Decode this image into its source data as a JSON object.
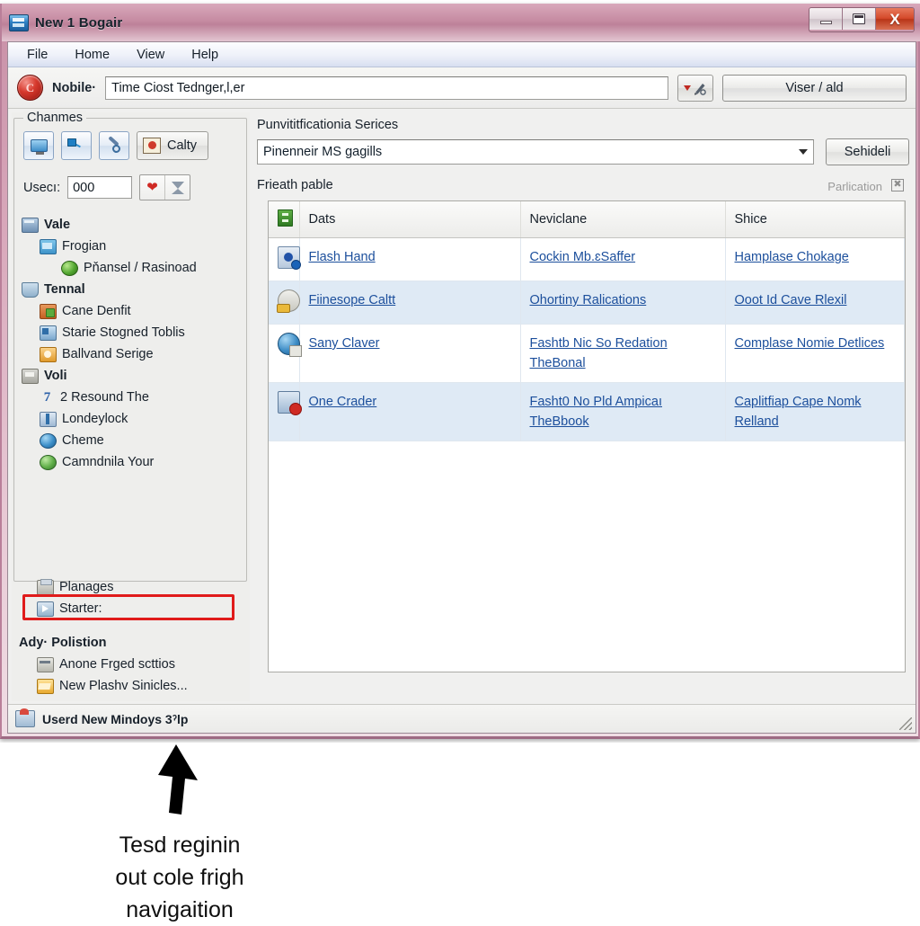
{
  "window": {
    "title": "New 1 Bogair",
    "logo_icon": "window-app-icon",
    "controls": {
      "minimize": "minimize-icon",
      "restore": "restore-icon",
      "close_label": "X"
    }
  },
  "menu": {
    "items": [
      {
        "label": "File",
        "name": "menu-file"
      },
      {
        "label": "Home",
        "name": "menu-home"
      },
      {
        "label": "View",
        "name": "menu-view"
      },
      {
        "label": "Help",
        "name": "menu-help"
      }
    ]
  },
  "address_bar": {
    "orb_icon": "app-orb-icon",
    "orb_letter": "C",
    "label": "Nobile·",
    "value": "Time Ciost Tednger,l,er",
    "placeholder": "Time Ciost Tednger,l,er",
    "tool_button_icon": "dropdown-pen-icon",
    "go_label": "Viser / ald"
  },
  "sidebar": {
    "group_legend": "Chanmes",
    "toolbar": [
      {
        "name": "monitor-button",
        "icon": "monitor-icon"
      },
      {
        "name": "network-button",
        "icon": "network-icon"
      },
      {
        "name": "wrench-button",
        "icon": "wrench-icon"
      }
    ],
    "calty_button": {
      "label": "Calty",
      "icon": "person-card-icon"
    },
    "users_label": "Usecı:",
    "users_value": "000",
    "users_placeholder": "000",
    "heart_icon": "heart-icon",
    "filter_icon": "filter-icon",
    "tree": [
      {
        "label": "Vale",
        "level": 0,
        "icon": "server-icon",
        "group": true
      },
      {
        "label": "Frogian",
        "level": 1,
        "icon": "folder-blue-icon",
        "group": false
      },
      {
        "label": "Pňansel / Rasinoad",
        "level": 2,
        "icon": "globe-green-icon",
        "group": false
      },
      {
        "label": "Tennal",
        "level": 0,
        "icon": "shield-icon",
        "group": true
      },
      {
        "label": "Cane Denfit",
        "level": 1,
        "icon": "users-icon",
        "group": false
      },
      {
        "label": "Starie Stogned Toblis",
        "level": 1,
        "icon": "monitor-small-icon",
        "group": false
      },
      {
        "label": "Ballvand Serige",
        "level": 1,
        "icon": "orange-gear-icon",
        "group": false
      },
      {
        "label": "Voli",
        "level": 0,
        "icon": "group-icon",
        "group": true
      },
      {
        "label": "2 Resound The",
        "level": 1,
        "icon": "seven-icon",
        "group": false
      },
      {
        "label": "Londeylock",
        "level": 1,
        "icon": "book-icon",
        "group": false
      },
      {
        "label": "Cheme",
        "level": 1,
        "icon": "ie-globe-icon",
        "group": false
      },
      {
        "label": "Camndnila Your",
        "level": 1,
        "icon": "green-ball-icon",
        "group": false
      }
    ],
    "tree_outside": [
      {
        "label": "Planages",
        "level": 1,
        "icon": "printer-icon",
        "group": false
      },
      {
        "label": "Starter:",
        "level": 1,
        "icon": "starter-icon",
        "group": false,
        "highlighted": true
      }
    ],
    "advanced_header": "Ady· Polistion",
    "advanced_items": [
      {
        "label": "Anone Frged scttios",
        "icon": "keyboard-icon"
      },
      {
        "label": "New Plashv Sinicles...",
        "icon": "folder-yellow-icon"
      }
    ],
    "highlight_color": "#e01b1b"
  },
  "main": {
    "services_label": "Punvititficationia Serices",
    "combo_value": "Pinenneir MS gagills",
    "combo_arrow_icon": "chevron-down-icon",
    "schedule_button": "Sehideli",
    "table_caption": "Frieath pable",
    "publication_status": "Parlication",
    "publication_icon": "publication-icon",
    "table": {
      "columns": [
        {
          "label": "",
          "name": "col-icon",
          "icon": "status-column-icon"
        },
        {
          "label": "Dats",
          "name": "col-dats"
        },
        {
          "label": "Neviclane",
          "name": "col-neviclane"
        },
        {
          "label": "Shice",
          "name": "col-shice"
        }
      ],
      "rows": [
        {
          "icon": "disk-icon",
          "dats": "Flash Hand",
          "neviclane": "Cockin Mb.ɛSaffer",
          "shice": "Hamplase Chokage",
          "alt": false
        },
        {
          "icon": "key-icon",
          "dats": "Fiinesope Caltt",
          "neviclane": "Ohortiny Ralications",
          "shice": "Ooot Id Cave Rlexil",
          "alt": true
        },
        {
          "icon": "globe-drive-icon",
          "dats": "Sany Claver",
          "neviclane": "Fashtb Nic So Redation TheBonal",
          "shice": "Complase Nomie Detlices",
          "alt": false
        },
        {
          "icon": "lock-icon",
          "dats": "One Crader",
          "neviclane": "Fasht0 No Pld Ampicaı TheBbook",
          "shice": "Caplitfiap Cape Nomk Relland",
          "alt": true
        }
      ]
    }
  },
  "status_bar": {
    "icon": "status-user-icon",
    "text": "Userd New Mindoys 3ˀlp",
    "resize_grip_icon": "resize-grip-icon"
  },
  "annotation": {
    "arrow_icon": "up-arrow-icon",
    "lines": [
      "Tesd reginin",
      "out cole frigh",
      "navigaition"
    ]
  }
}
